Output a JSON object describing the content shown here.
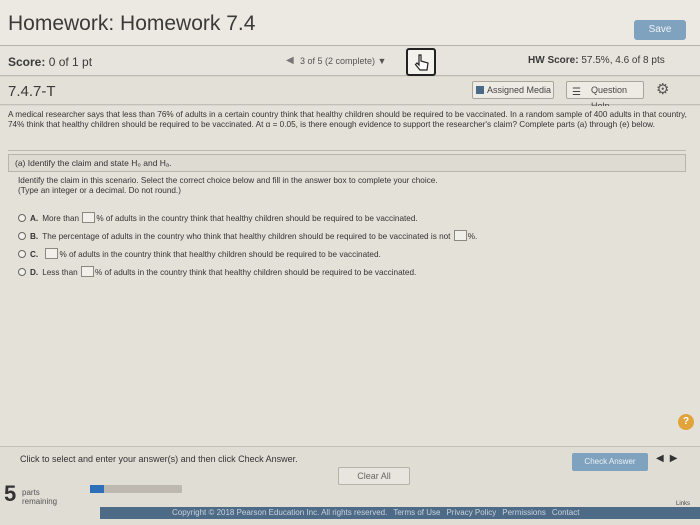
{
  "header": {
    "title": "Homework: Homework 7.4",
    "save_label": "Save"
  },
  "score_bar": {
    "score_label": "Score:",
    "score_value": "0 of 1 pt",
    "prev_arrow": "◀",
    "progress_select": "3 of 5 (2 complete) ▼",
    "hw_score_label": "HW Score:",
    "hw_score_value": "57.5%, 4.6 of 8 pts"
  },
  "sub_bar": {
    "section": "7.4.7-T",
    "assigned_media": "Assigned Media",
    "question_help": "Question Help"
  },
  "problem": {
    "text": "A medical researcher says that less than 76% of adults in a certain country think that healthy children should be required to be vaccinated. In a random sample of 400 adults in that country, 74% think that healthy children should be required to be vaccinated. At α = 0.05, is there enough evidence to support the researcher's claim? Complete parts (a) through (e) below.",
    "part_a": "(a) Identify the claim and state H₀ and Hₐ.",
    "instruction_1": "Identify the claim in this scenario. Select the correct choice below and fill in the answer box to complete your choice.",
    "instruction_2": "(Type an integer or a decimal. Do not round.)",
    "choices": [
      {
        "letter": "A.",
        "pre": "More than",
        "post": "% of adults in the country think that healthy children should be required to be vaccinated."
      },
      {
        "letter": "B.",
        "pre": "The percentage of adults in the country who think that healthy children should be required to be vaccinated is not",
        "post": "%."
      },
      {
        "letter": "C.",
        "pre": "",
        "post": "% of adults in the country think that healthy children should be required to be vaccinated."
      },
      {
        "letter": "D.",
        "pre": "Less than",
        "post": "% of adults in the country think that healthy children should be required to be vaccinated."
      }
    ]
  },
  "footer": {
    "click_msg": "Click to select and enter your answer(s) and then click Check Answer.",
    "check_answer": "Check Answer",
    "clear_all": "Clear All",
    "parts_count": "5",
    "parts_label_1": "parts",
    "parts_label_2": "remaining",
    "parts_progress_fraction": 0.15,
    "copyright": "Copyright © 2018 Pearson Education Inc. All rights reserved.",
    "terms": "Terms of Use",
    "privacy": "Privacy Policy",
    "permissions": "Permissions",
    "contact": "Contact",
    "links": "Links"
  },
  "colors": {
    "accent_button": "#7fa3bf",
    "progress_fill": "#2d6fb8",
    "help_badge": "#e1a43a"
  },
  "icons": [
    "cursor-hand-icon",
    "media-icon",
    "list-icon",
    "gear-icon",
    "help-icon",
    "prev-arrow-icon",
    "next-arrow-icon"
  ]
}
